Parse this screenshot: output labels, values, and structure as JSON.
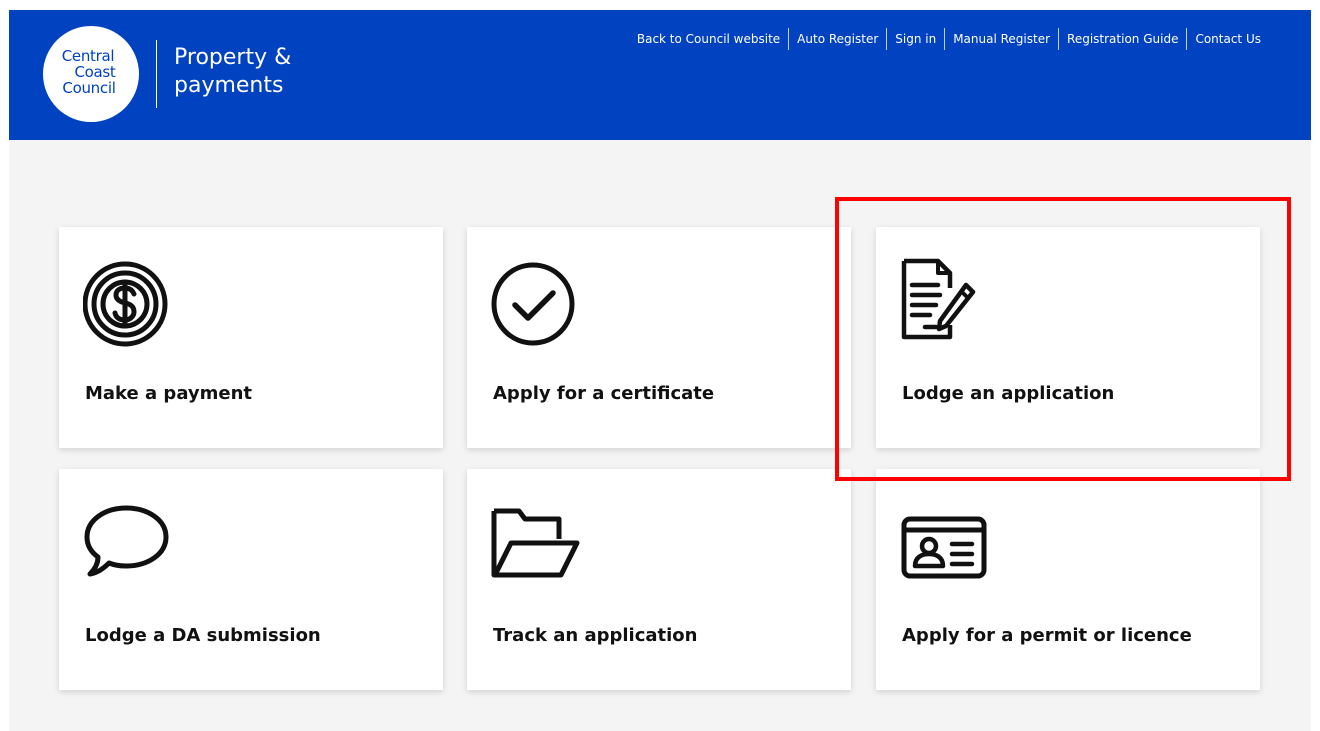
{
  "header": {
    "logo": {
      "line1": "Central",
      "line2": "Coast",
      "line3": "Council"
    },
    "title_line1": "Property &",
    "title_line2": "payments",
    "bg_color": "#0042bf"
  },
  "nav": {
    "items": [
      {
        "label": "Back to Council website"
      },
      {
        "label": "Auto Register"
      },
      {
        "label": "Sign in"
      },
      {
        "label": "Manual Register"
      },
      {
        "label": "Registration Guide"
      },
      {
        "label": "Contact Us"
      }
    ]
  },
  "tiles": [
    {
      "label": "Make a payment",
      "icon": "dollar-coin-icon"
    },
    {
      "label": "Apply for a certificate",
      "icon": "checkmark-circle-icon"
    },
    {
      "label": "Lodge an application",
      "icon": "document-pen-icon"
    },
    {
      "label": "Lodge a DA submission",
      "icon": "speech-bubble-icon"
    },
    {
      "label": "Track an application",
      "icon": "open-folder-icon"
    },
    {
      "label": "Apply for a permit or licence",
      "icon": "id-card-icon"
    }
  ],
  "highlight_color": "#ff0000"
}
